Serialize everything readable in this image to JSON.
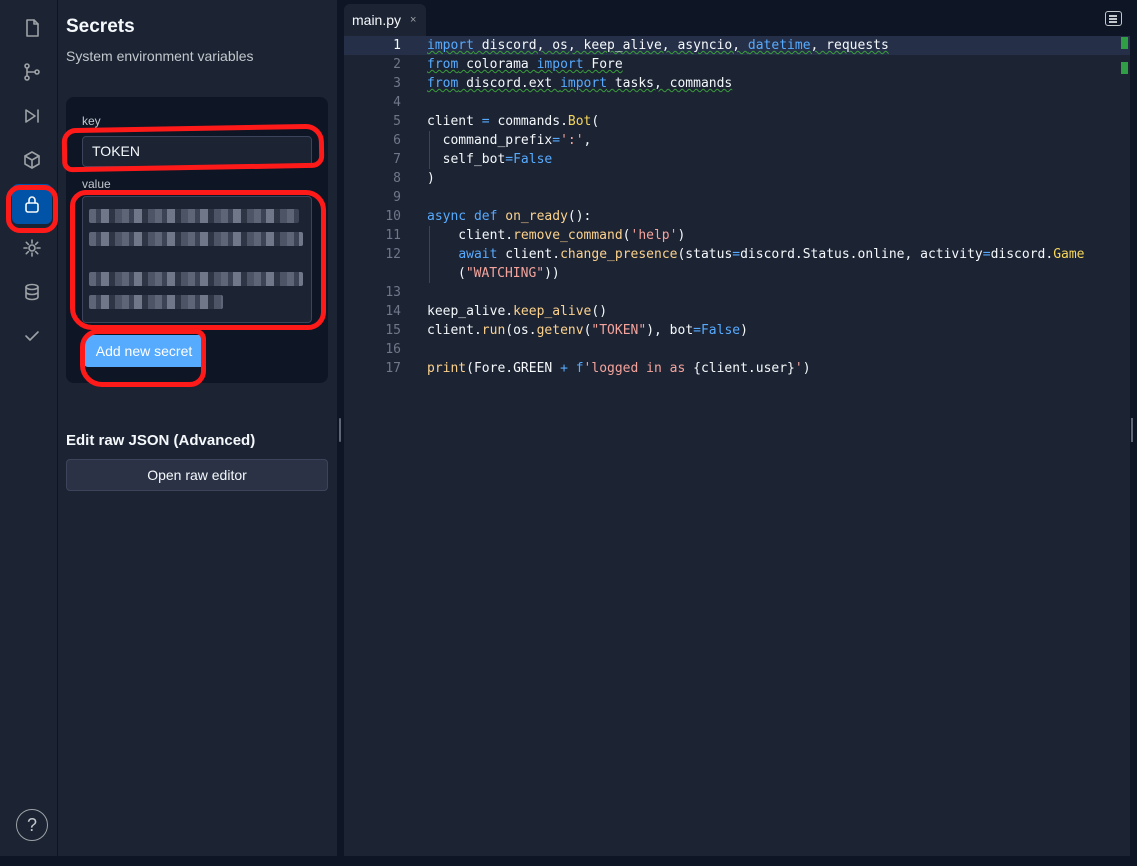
{
  "rail": {
    "items": [
      "files",
      "git",
      "run",
      "packages",
      "secrets",
      "settings",
      "database",
      "checks"
    ],
    "active": "secrets",
    "help_label": "?"
  },
  "secrets": {
    "title": "Secrets",
    "subtitle": "System environment variables",
    "key_label": "key",
    "key_value": "TOKEN",
    "value_label": "value",
    "add_button": "Add new secret",
    "raw_title": "Edit raw JSON (Advanced)",
    "raw_button": "Open raw editor"
  },
  "editor": {
    "tab": {
      "name": "main.py",
      "close": "×"
    },
    "current_line": 1,
    "lines": [
      {
        "n": "1"
      },
      {
        "n": "2"
      },
      {
        "n": "3"
      },
      {
        "n": "4"
      },
      {
        "n": "5"
      },
      {
        "n": "6"
      },
      {
        "n": "7"
      },
      {
        "n": "8"
      },
      {
        "n": "9"
      },
      {
        "n": "10"
      },
      {
        "n": "11"
      },
      {
        "n": "12"
      },
      {
        "n": ""
      },
      {
        "n": "13"
      },
      {
        "n": "14"
      },
      {
        "n": "15"
      },
      {
        "n": "16"
      },
      {
        "n": "17"
      }
    ]
  },
  "colors": {
    "background": "#0e1525",
    "panel": "#1c2333",
    "accent_active": "#0053a6",
    "button_primary": "#57abff",
    "annotation_red": "#ff1a1a"
  }
}
